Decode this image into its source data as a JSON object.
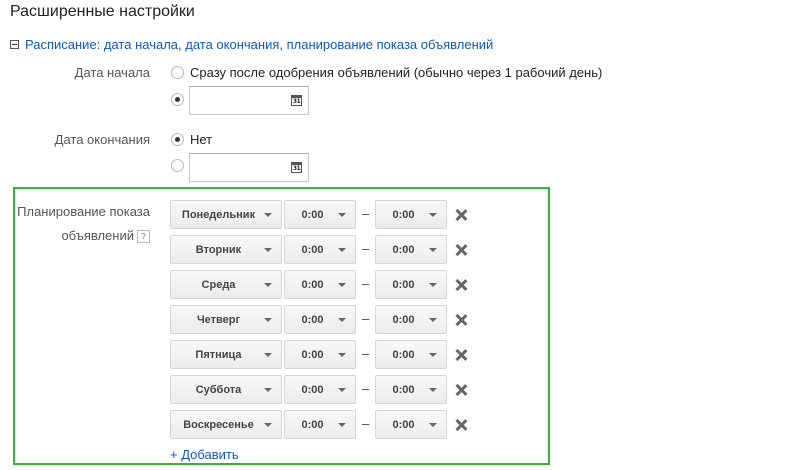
{
  "header": {
    "title": "Расширенные настройки"
  },
  "schedule_section": {
    "link_text": "Расписание: дата начала, дата окончания, планирование показа объявлений",
    "start_date": {
      "label": "Дата начала",
      "option_immediate": "Сразу после одобрения объявлений (обычно через 1 рабочий день)",
      "selected": "custom",
      "date_value": ""
    },
    "end_date": {
      "label": "Дата окончания",
      "option_none": "Нет",
      "selected": "none",
      "date_value": ""
    },
    "calendar_icon_text": "31",
    "ad_scheduling": {
      "label_line1": "Планирование показа",
      "label_line2": "объявлений",
      "help": "?",
      "dash": "–",
      "rows": [
        {
          "day": "Понедельник",
          "from": "0:00",
          "to": "0:00"
        },
        {
          "day": "Вторник",
          "from": "0:00",
          "to": "0:00"
        },
        {
          "day": "Среда",
          "from": "0:00",
          "to": "0:00"
        },
        {
          "day": "Четверг",
          "from": "0:00",
          "to": "0:00"
        },
        {
          "day": "Пятница",
          "from": "0:00",
          "to": "0:00"
        },
        {
          "day": "Суббота",
          "from": "0:00",
          "to": "0:00"
        },
        {
          "day": "Воскресенье",
          "from": "0:00",
          "to": "0:00"
        }
      ],
      "add_link": "+ Добавить"
    }
  },
  "colors": {
    "link": "#1155cc",
    "highlight_border": "#35b535"
  }
}
